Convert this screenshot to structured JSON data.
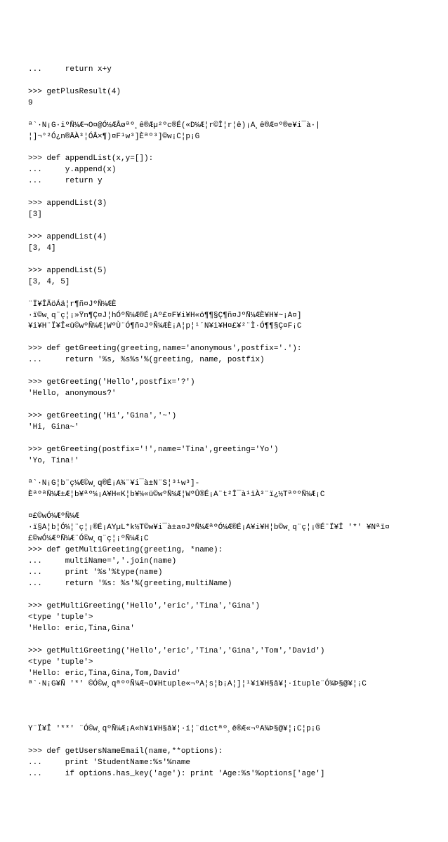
{
  "lines": [
    "...     return x+y",
    "",
    ">>> getPlusResult(4)",
    "9",
    "",
    "ª`·N¡G·iºÑ¼Æ¬O¤@Ó½ÆÂøªº¸ê®Æµ²ºc®É(«D¼Æ¦r©Î¦r¦ê)¡A¸ê®Æ¤º®e¥i¯à·|",
    "¦]¬°²Ó¿n®ÄÀ³¦ÓÂ×¶)¤F¹w³]Èªº³]©w¡C¦p¡G",
    "",
    ">>> def appendList(x,y=[]):",
    "...     y.append(x)",
    "...     return y",
    "",
    ">>> appendList(3)",
    "[3]",
    "",
    ">>> appendList(4)",
    "[3, 4]",
    "",
    ">>> appendList(5)",
    "[3, 4, 5]",
    "",
    "¨Ï¥ÎÃöÁä¦r¶ñ¤JºÑ¼ÆÈ",
    "·ï©w¸q¨ç¦¡»Ÿn¶Ç¤J¦hÓºÑ¼Æ®É¡Aº£¤F¥i¥H«ö¶¶§Ç¶ñ¤JºÑ¼ÆÈ¥H¥~¡A¤]",
    "¥i¥H¨Ï¥Î«ü©wºÑ¼Æ¦WºÙ¨Ó¶ñ¤JºÑ¼ÆÈ¡A¦p¦¹´N¥i¥H¤£¥²¨Ì·Ó¶¶§Ç¤F¡C",
    "",
    ">>> def getGreeting(greeting,name='anonymous',postfix='.'):",
    "...     return '%s, %s%s'%(greeting, name, postfix)",
    "",
    ">>> getGreeting('Hello',postfix='?')",
    "'Hello, anonymous?'",
    "",
    ">>> getGreeting('Hi','Gina','~')",
    "'Hi, Gina~'",
    "",
    ">>> getGreeting(postfix='!',name='Tina',greeting='Yo')",
    "'Yo, Tina!'",
    "",
    "ª`·N¡G¦b¨ç¼Æ©w¸q®É¡A¾¨¥i¯à±N¨S¦³¹w³]-",
    "ÈªºªÑ¼Æ±Æ¦b¥ªº¼¡A¥H«K¦b¥¼«ü©wºÑ¼Æ¦WºÛ®É¡A¨t²Î¯à¹ïÀ³¨ï¿½TªººÑ¼Æ¡C",
    "",
    "¤£©wÓ¼ÆºÑ¼Æ",
    "·ï§A¦b¦Ó¼¦¨ç¦¡®É¡AYµL*k½T©w¥i¯à±a¤JºÑ¼ÆªºÓ¼Æ®É¡A¥i¥H¦b©w¸q¨ç¦¡®É¨Ï¥Î '*' ¥Nªï¤",
    "£©wÓ¼ÆºÑ¼Æ¨Ó©w¸q¨ç¦¡ºÑ¼Æ¡C",
    ">>> def getMultiGreeting(greeting, *name):",
    "...     multiName=','.join(name)",
    "...     print '%s'%type(name)",
    "...     return '%s: %s'%(greeting,multiName)",
    "",
    ">>> getMultiGreeting('Hello','eric','Tina','Gina')",
    "<type 'tuple'>",
    "'Hello: eric,Tina,Gina'",
    "",
    ">>> getMultiGreeting('Hello','eric','Tina','Gina','Tom','David')",
    "<type 'tuple'>",
    "'Hello: eric,Tina,Gina,Tom,David'",
    "ª`·N¡G¥Ñ '*' ©Ó©w¸qªººÑ¼Æ¬O¥Htuple«¬ºA¦s¦b¡A¦]¦¹¥i¥H§â¥¦·ítuple¨Ó¾Þ§@¥¦¡C",
    "",
    "",
    "",
    "Y¨Ï¥Î '**' ¨Ó©w¸qºÑ¼Æ¡A«h¥i¥H§â¥¦·í¦¨dictªº¸ê®Æ«¬ºA¾Þ§@¥¦¡C¦p¡G",
    "",
    ">>> def getUsersNameEmail(name,**options):",
    "...     print 'StudentName:%s'%name",
    "...     if options.has_key('age'): print 'Age:%s'%options['age']"
  ]
}
